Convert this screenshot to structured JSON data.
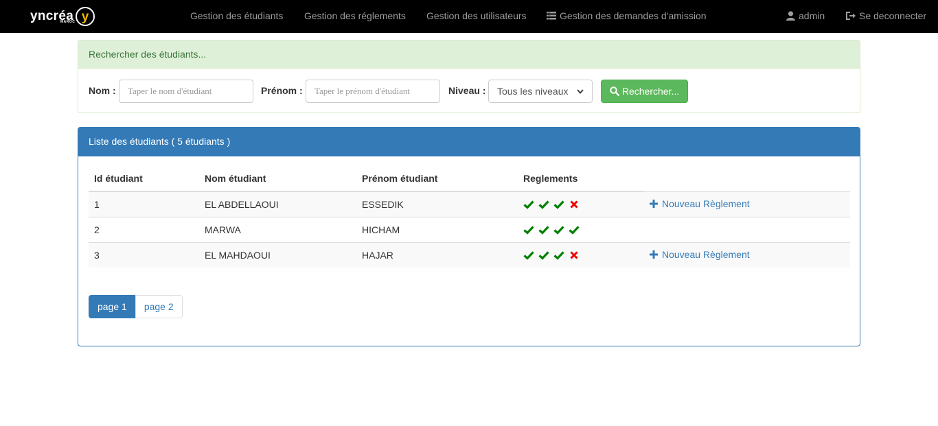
{
  "brand": {
    "name": "yncréa",
    "sub": "MAROC",
    "letter": "y"
  },
  "nav": {
    "etudiants": "Gestion des étudiants",
    "reglements": "Gestion des réglements",
    "utilisateurs": "Gestion des utilisateurs",
    "demandes": "Gestion des demandes d'amission",
    "user": "admin",
    "logout": "Se deconnecter"
  },
  "search": {
    "heading": "Rechercher des étudiants...",
    "nom_label": "Nom :",
    "nom_placeholder": "Taper le nom d'étudiant",
    "prenom_label": "Prénom :",
    "prenom_placeholder": "Taper le prénom d'étudiant",
    "niveau_label": "Niveau :",
    "niveau_selected": "Tous les niveaux",
    "button": "Rechercher..."
  },
  "list": {
    "heading": "Liste des étudiants ( 5 étudiants )",
    "columns": [
      "Id étudiant",
      "Nom étudiant",
      "Prénom étudiant",
      "Reglements"
    ],
    "rows": [
      {
        "id": "1",
        "nom": "EL ABDELLAOUI",
        "prenom": "ESSEDIK",
        "reglements": [
          "ok",
          "ok",
          "ok",
          "no"
        ],
        "action": "Nouveau Règlement"
      },
      {
        "id": "2",
        "nom": "MARWA",
        "prenom": "HICHAM",
        "reglements": [
          "ok",
          "ok",
          "ok",
          "ok"
        ],
        "action": ""
      },
      {
        "id": "3",
        "nom": "EL MAHDAOUI",
        "prenom": "HAJAR",
        "reglements": [
          "ok",
          "ok",
          "ok",
          "no"
        ],
        "action": "Nouveau Règlement"
      }
    ]
  },
  "pagination": {
    "page1": "page 1",
    "page2": "page 2"
  },
  "colors": {
    "ok": "#008000",
    "no": "#ee0000",
    "primary": "#337ab7",
    "success": "#5cb85c"
  }
}
